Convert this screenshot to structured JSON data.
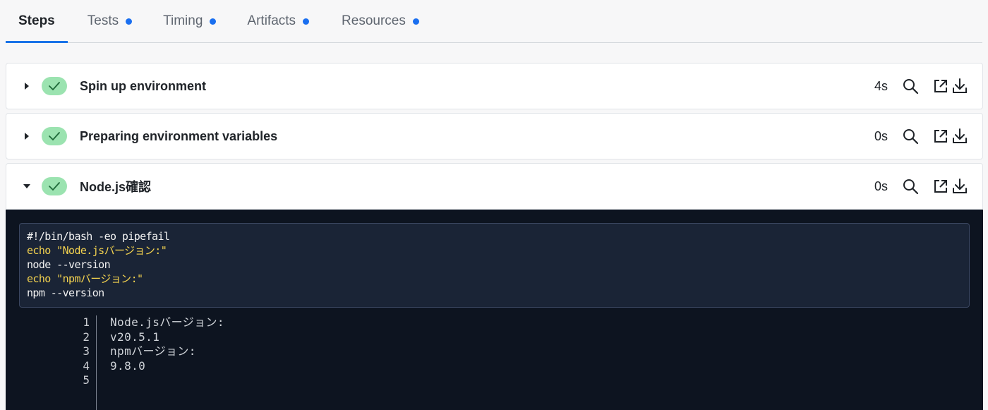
{
  "tabs": [
    {
      "label": "Steps",
      "active": true,
      "dot": false
    },
    {
      "label": "Tests",
      "active": false,
      "dot": true
    },
    {
      "label": "Timing",
      "active": false,
      "dot": true
    },
    {
      "label": "Artifacts",
      "active": false,
      "dot": true
    },
    {
      "label": "Resources",
      "active": false,
      "dot": true
    }
  ],
  "steps": [
    {
      "title": "Spin up environment",
      "duration": "4s",
      "status": "success",
      "expanded": false
    },
    {
      "title": "Preparing environment variables",
      "duration": "0s",
      "status": "success",
      "expanded": false
    },
    {
      "title": "Node.js確認",
      "duration": "0s",
      "status": "success",
      "expanded": true
    }
  ],
  "script": {
    "lines": [
      {
        "text": "#!/bin/bash -eo pipefail",
        "color": "#f2f2f2"
      },
      {
        "text": "echo \"Node.jsバージョン:\"",
        "color": "#f3d24f"
      },
      {
        "text": "node --version",
        "color": "#f2f2f2"
      },
      {
        "text": "echo \"npmバージョン:\"",
        "color": "#f3d24f"
      },
      {
        "text": "npm --version",
        "color": "#f2f2f2"
      }
    ]
  },
  "output": {
    "line_numbers": [
      "1",
      "2",
      "3",
      "4",
      "5"
    ],
    "lines": [
      "Node.jsバージョン:",
      "v20.5.1",
      "npmバージョン:",
      "9.8.0",
      ""
    ]
  },
  "icons": {
    "success": "check-icon",
    "search": "search-icon",
    "open": "external-link-icon",
    "download": "download-icon"
  },
  "colors": {
    "accent": "#1a73e8",
    "success_bg": "#9be3b0",
    "terminal_bg": "#0d1420",
    "script_yellow": "#f3d24f"
  }
}
